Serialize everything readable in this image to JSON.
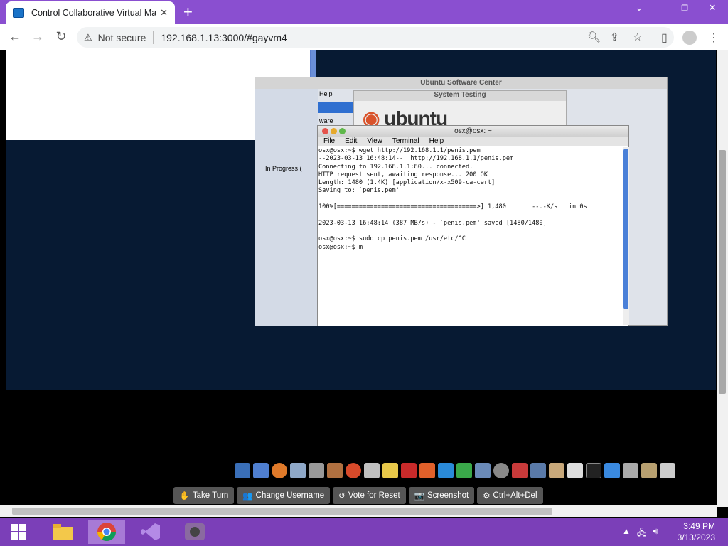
{
  "browser": {
    "tab_title": "Control Collaborative Virtual Ma",
    "tab_close": "✕",
    "new_tab": "+",
    "security": "Not secure",
    "url": "192.168.1.13:3000/#gayvm4"
  },
  "vm": {
    "usc_title": "Ubuntu Software Center",
    "usc_menu": "Help",
    "usc_item": "ware",
    "usc_inprogress": "In Progress (",
    "systest_title": "System Testing",
    "systest_logo": "ubuntu",
    "terminal_title": "osx@osx: ~",
    "terminal_menu": [
      "File",
      "Edit",
      "View",
      "Terminal",
      "Help"
    ],
    "terminal_lines": [
      "osx@osx:~$ wget http://192.168.1.1/penis.pem",
      "--2023-03-13 16:48:14--  http://192.168.1.1/penis.pem",
      "Connecting to 192.168.1.1:80... connected.",
      "HTTP request sent, awaiting response... 200 OK",
      "Length: 1480 (1.4K) [application/x-x509-ca-cert]",
      "Saving to: `penis.pem'",
      "",
      "100%[======================================>] 1,480       --.-K/s   in 0s",
      "",
      "2023-03-13 16:48:14 (387 MB/s) - `penis.pem' saved [1480/1480]",
      "",
      "osx@osx:~$ sudo cp penis.pem /usr/etc/^C",
      "osx@osx:~$ m"
    ]
  },
  "controls": {
    "take_turn": "Take Turn",
    "change_username": "Change Username",
    "vote_reset": "Vote for Reset",
    "screenshot": "Screenshot",
    "ctrl_alt_del": "Ctrl+Alt+Del"
  },
  "taskbar": {
    "time": "3:49 PM",
    "date": "3/13/2023"
  },
  "colors": {
    "tabbar": "#8a4fd0",
    "taskbar": "#7b3fb8",
    "vm_desktop": "#071a33"
  }
}
